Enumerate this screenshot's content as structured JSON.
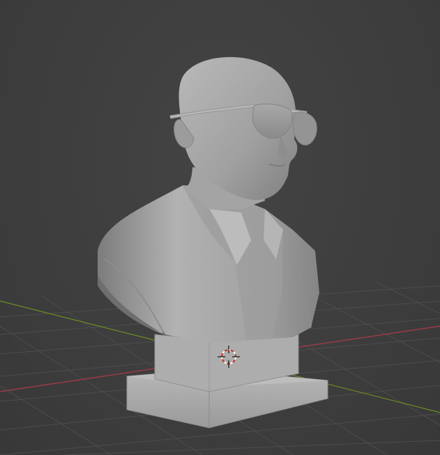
{
  "viewport": {
    "background_color": "#3d3d3d",
    "grid_color": "#525252",
    "x_axis_color": "#9a3b45",
    "y_axis_color": "#6b8e23",
    "model_color": "#a9a9a9",
    "cursor_icon": "3d-cursor-icon"
  }
}
